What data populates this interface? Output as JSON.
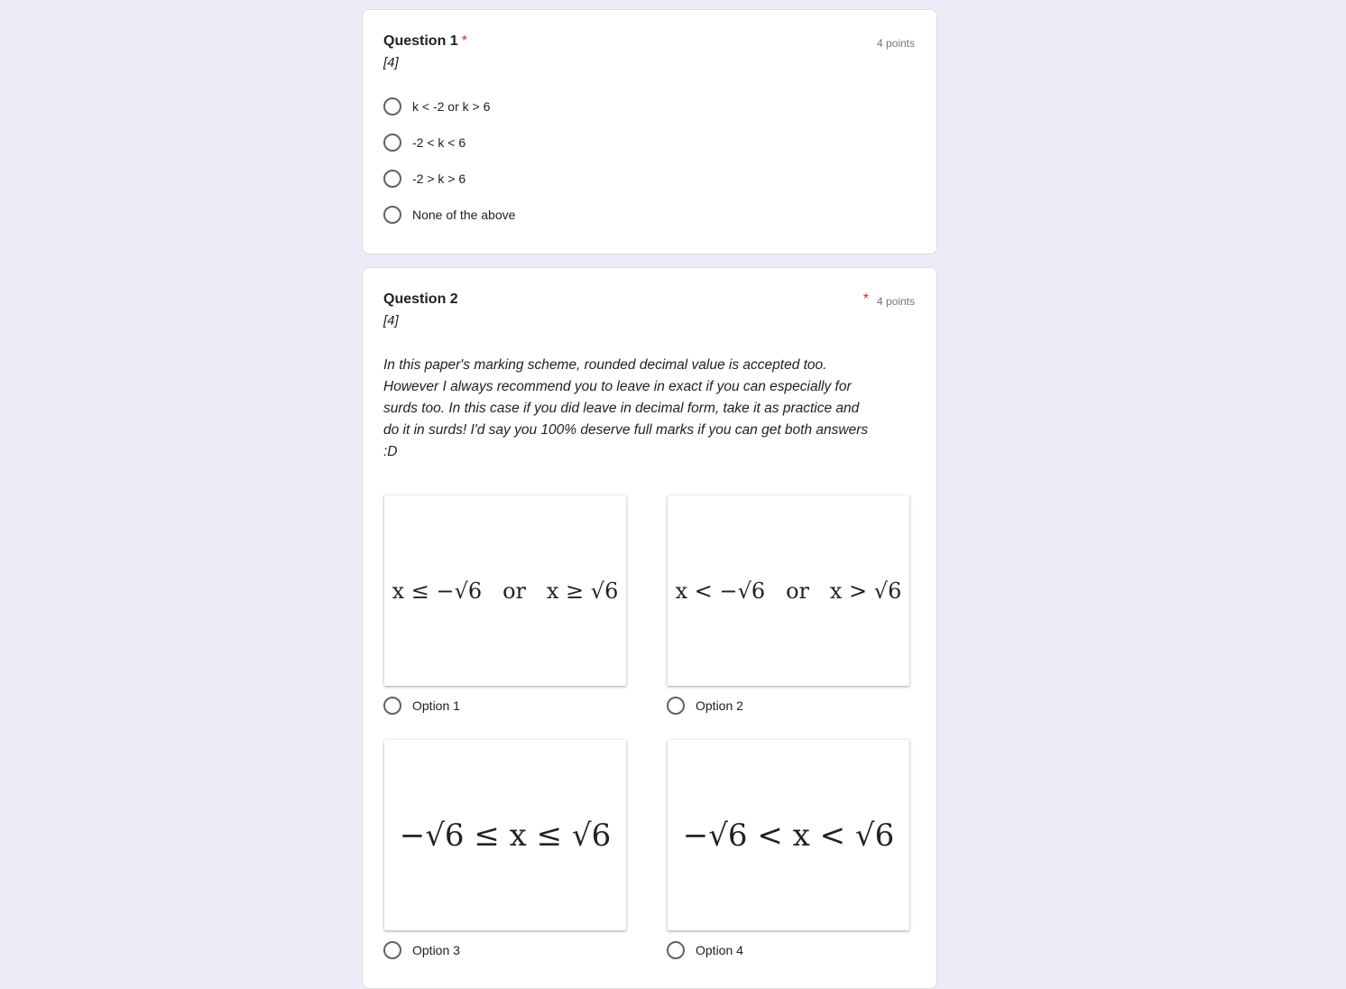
{
  "question1": {
    "title": "Question 1",
    "required_mark": "*",
    "points": "4 points",
    "description": "[4]",
    "options": [
      "k < -2 or k > 6",
      "-2 < k < 6",
      "-2 > k > 6",
      "None of the above"
    ]
  },
  "question2": {
    "title": "Question 2",
    "required_mark": "*",
    "points": "4 points",
    "description": "[4]",
    "long_description": "In this paper's marking scheme, rounded decimal value is accepted too. However I always recommend you to leave in exact if you can especially for surds too. In this case if you did leave in decimal form, take it as practice and do it in surds! I'd say you 100% deserve full marks if you can get both answers :D",
    "image_options": [
      {
        "label": "Option 1",
        "math": "x ≤ −√6   or   x ≥ √6"
      },
      {
        "label": "Option 2",
        "math": "x < −√6   or   x > √6"
      },
      {
        "label": "Option 3",
        "math": "−√6 ≤ x ≤ √6"
      },
      {
        "label": "Option 4",
        "math": "−√6 < x < √6"
      }
    ]
  }
}
